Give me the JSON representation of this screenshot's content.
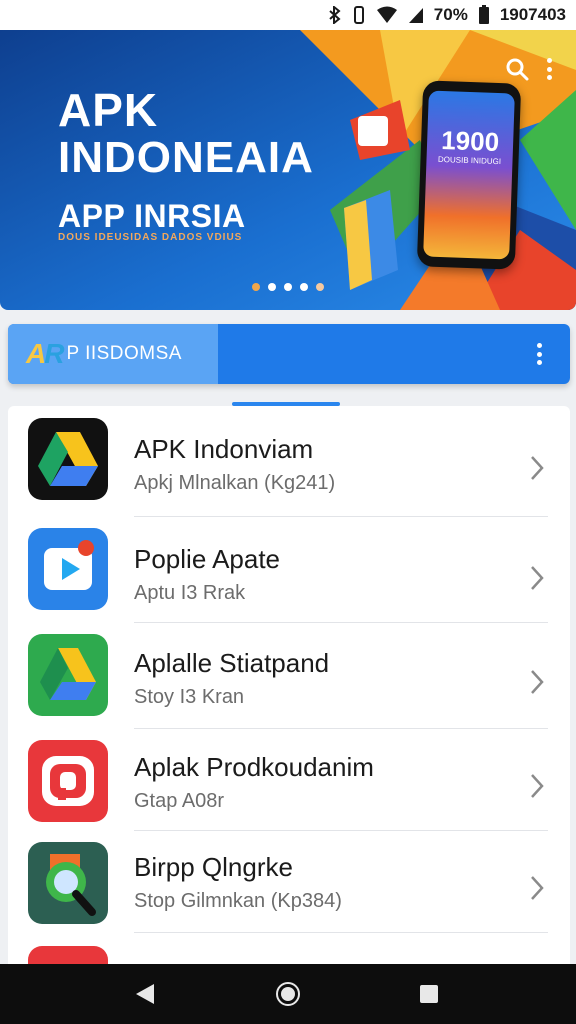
{
  "status_bar": {
    "battery_percent": "70%",
    "time": "1907403",
    "icons": [
      "bluetooth-icon",
      "vibrate-icon",
      "wifi-icon",
      "signal-icon",
      "battery-icon"
    ]
  },
  "hero": {
    "title_line1": "APK",
    "title_line2": "INDONEAIA",
    "subtitle": "APP INRSIA",
    "tagline": "DOUS IDEUSIDAS DADOS VDIUS",
    "phone_number": "1900",
    "phone_caption": "DOUSIB INIDUGI",
    "carousel_count": 5,
    "carousel_active_index": 0,
    "colors": {
      "blue": "#1659b6",
      "orange": "#f39a1f",
      "green": "#3fb64a",
      "red": "#e8442b"
    }
  },
  "appbar": {
    "logo": {
      "a": "A",
      "r": "R"
    },
    "label": "P IISDOMSA",
    "color": "#1f7ae8",
    "tab_color": "#5aa4f4"
  },
  "apps": [
    {
      "title": "APK Indonviam",
      "subtitle": "Apkj Mlnalkan (Kg241)",
      "icon": "drive-icon"
    },
    {
      "title": "Poplie Apate",
      "subtitle": "Aptu I3 Rrak",
      "icon": "video-player-icon"
    },
    {
      "title": "Aplalle Stiatpand",
      "subtitle": "Stoy I3 Kran",
      "icon": "drive-icon"
    },
    {
      "title": "Aplak Prodkoudanim",
      "subtitle": "Gtap A08r",
      "icon": "red-brand-icon"
    },
    {
      "title": "Birpp Qlngrke",
      "subtitle": "Stop Gilmnkan (Kp384)",
      "icon": "search-lens-icon"
    }
  ]
}
